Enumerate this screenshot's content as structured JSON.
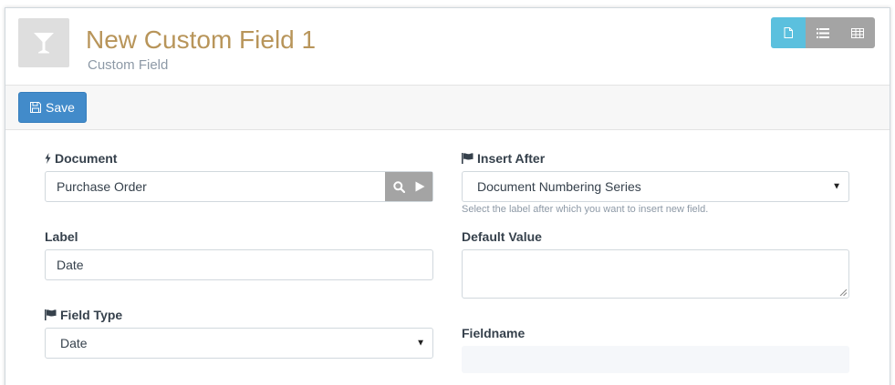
{
  "header": {
    "title": "New Custom Field 1",
    "subtitle": "Custom Field"
  },
  "toolbar": {
    "save_label": "Save"
  },
  "form": {
    "document": {
      "label": "Document",
      "value": "Purchase Order"
    },
    "insert_after": {
      "label": "Insert After",
      "value": "Document Numbering Series",
      "help": "Select the label after which you want to insert new field."
    },
    "label_field": {
      "label": "Label",
      "value": "Date"
    },
    "default_value": {
      "label": "Default Value",
      "value": ""
    },
    "field_type": {
      "label": "Field Type",
      "value": "Date"
    },
    "fieldname": {
      "label": "Fieldname",
      "value": ""
    }
  },
  "colors": {
    "title": "#b8955a",
    "primary": "#428bca",
    "view_active": "#5bc0de",
    "view_inactive": "#a4a4a4"
  },
  "icons": {
    "app": "cocktail-glass-icon",
    "document_label": "bolt-icon",
    "insert_after_label": "flag-icon",
    "field_type_label": "flag-icon",
    "save": "floppy-disk-icon",
    "views": [
      "document-icon",
      "list-icon",
      "table-icon"
    ]
  }
}
